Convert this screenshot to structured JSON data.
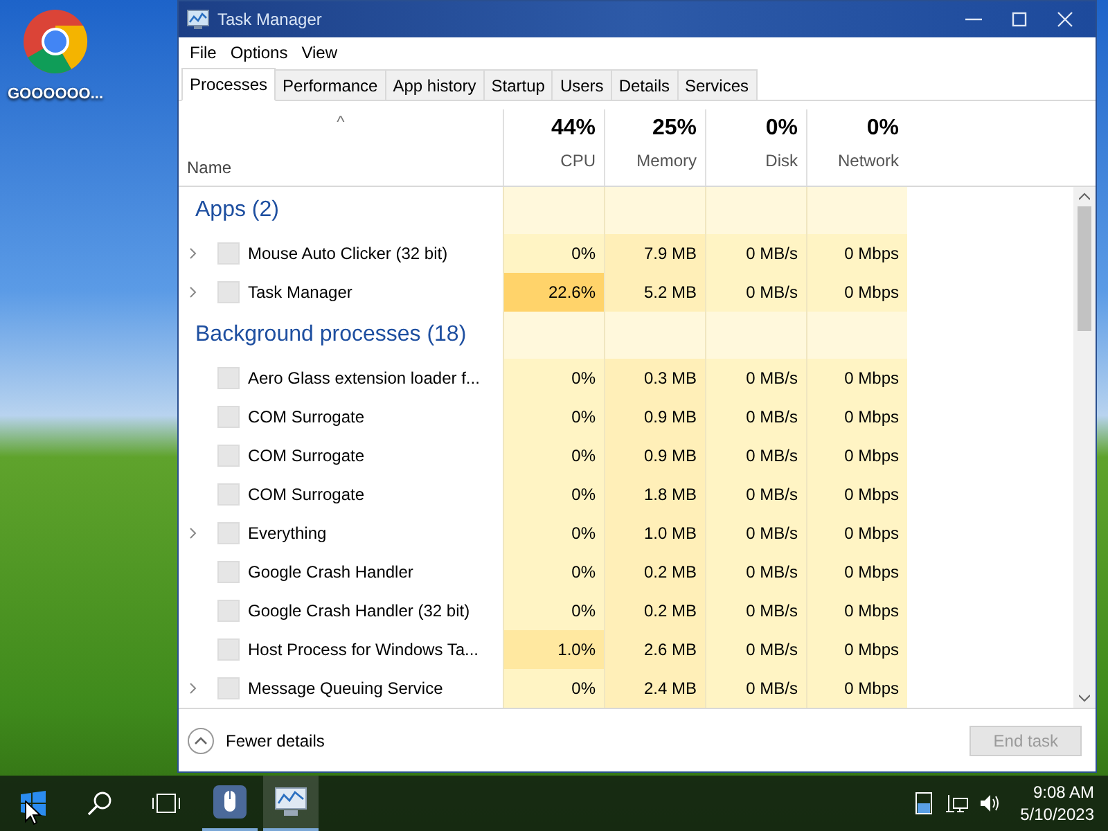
{
  "desktop": {
    "icons": [
      {
        "label": "GOOOOOO..."
      }
    ]
  },
  "window": {
    "title": "Task Manager"
  },
  "menu": [
    "File",
    "Options",
    "View"
  ],
  "tabs": [
    {
      "label": "Processes",
      "selected": true
    },
    {
      "label": "Performance",
      "selected": false
    },
    {
      "label": "App history",
      "selected": false
    },
    {
      "label": "Startup",
      "selected": false
    },
    {
      "label": "Users",
      "selected": false
    },
    {
      "label": "Details",
      "selected": false
    },
    {
      "label": "Services",
      "selected": false
    }
  ],
  "table": {
    "sort_indicator": "^",
    "columns": [
      {
        "label": "Name"
      },
      {
        "label": "CPU",
        "total": "44%"
      },
      {
        "label": "Memory",
        "total": "25%"
      },
      {
        "label": "Disk",
        "total": "0%"
      },
      {
        "label": "Network",
        "total": "0%"
      }
    ],
    "groups": [
      {
        "title": "Apps (2)",
        "rows": [
          {
            "name": "Mouse Auto Clicker (32 bit)",
            "expandable": true,
            "cpu": "0%",
            "color": "#fff4c4",
            "memory": "7.9 MB",
            "disk": "0 MB/s",
            "network": "0 Mbps"
          },
          {
            "name": "Task Manager",
            "expandable": true,
            "cpu": "22.6%",
            "color": "#ffd36a",
            "memory": "5.2 MB",
            "disk": "0 MB/s",
            "network": "0 Mbps"
          }
        ]
      },
      {
        "title": "Background processes (18)",
        "rows": [
          {
            "name": "Aero Glass extension loader f...",
            "expandable": false,
            "cpu": "0%",
            "color": "#fff4c4",
            "memory": "0.3 MB",
            "disk": "0 MB/s",
            "network": "0 Mbps"
          },
          {
            "name": "COM Surrogate",
            "expandable": false,
            "cpu": "0%",
            "color": "#fff4c4",
            "memory": "0.9 MB",
            "disk": "0 MB/s",
            "network": "0 Mbps"
          },
          {
            "name": "COM Surrogate",
            "expandable": false,
            "cpu": "0%",
            "color": "#fff4c4",
            "memory": "0.9 MB",
            "disk": "0 MB/s",
            "network": "0 Mbps"
          },
          {
            "name": "COM Surrogate",
            "expandable": false,
            "cpu": "0%",
            "color": "#fff4c4",
            "memory": "1.8 MB",
            "disk": "0 MB/s",
            "network": "0 Mbps"
          },
          {
            "name": "Everything",
            "expandable": true,
            "cpu": "0%",
            "color": "#fff4c4",
            "memory": "1.0 MB",
            "disk": "0 MB/s",
            "network": "0 Mbps"
          },
          {
            "name": "Google Crash Handler",
            "expandable": false,
            "cpu": "0%",
            "color": "#fff4c4",
            "memory": "0.2 MB",
            "disk": "0 MB/s",
            "network": "0 Mbps"
          },
          {
            "name": "Google Crash Handler (32 bit)",
            "expandable": false,
            "cpu": "0%",
            "color": "#fff4c4",
            "memory": "0.2 MB",
            "disk": "0 MB/s",
            "network": "0 Mbps"
          },
          {
            "name": "Host Process for Windows Ta...",
            "expandable": false,
            "cpu": "1.0%",
            "color": "#ffe8a0",
            "memory": "2.6 MB",
            "disk": "0 MB/s",
            "network": "0 Mbps"
          },
          {
            "name": "Message Queuing Service",
            "expandable": true,
            "cpu": "0%",
            "color": "#fff4c4",
            "memory": "2.4 MB",
            "disk": "0 MB/s",
            "network": "0 Mbps"
          }
        ]
      }
    ]
  },
  "footer": {
    "fewer_details": "Fewer details",
    "end_task": {
      "label": "End task",
      "disabled": true
    }
  },
  "taskbar": {
    "time": "9:08 AM",
    "date": "5/10/2023"
  }
}
